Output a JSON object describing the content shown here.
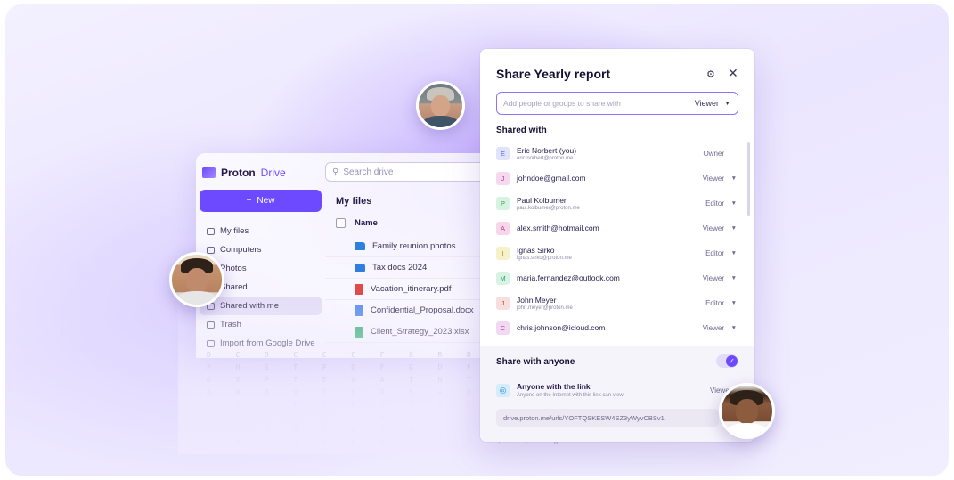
{
  "drive": {
    "brand_main": "Proton",
    "brand_sub": "Drive",
    "search_placeholder": "Search drive",
    "new_button": "New",
    "nav": [
      "My files",
      "Computers",
      "Photos",
      "Shared",
      "Shared with me",
      "Trash",
      "Import from Google Drive"
    ],
    "main_title": "My files",
    "column_name": "Name",
    "files": [
      {
        "name": "Family reunion photos",
        "type": "folder"
      },
      {
        "name": "Tax docs 2024",
        "type": "folder"
      },
      {
        "name": "Vacation_itinerary.pdf",
        "type": "pdf"
      },
      {
        "name": "Confidential_Proposal.docx",
        "type": "doc"
      },
      {
        "name": "Client_Strategy_2023.xlsx",
        "type": "sheet"
      }
    ],
    "cipher": "D  C  D  C  C  C  F  O  R  D  C  B  C\nP  H  S  T  P  D  F  G  D  F  P  F  F  G  M  H  P\nG  X  P  T  E  V  A  I  N  T  A  H  L\nA  N  D  V  3  H  R  S  +  H  E  3  S  3  R  S  A  N\nQ  X  T  R  S  P  U  S  X  R  Y  K  A  A\n4  F  5  P  P  5  D  C  G  F  E  G  C\nA  F  H  N  A  D  T  I  T  L  Y  Y  E  L\nD  N  C  Q  R  P  O  A  A  B  O  F  N"
  },
  "dialog": {
    "title": "Share Yearly report",
    "input_placeholder": "Add people or groups to share with",
    "input_role": "Viewer",
    "shared_with_label": "Shared with",
    "people": [
      {
        "initial": "E",
        "name": "Eric Norbert (you)",
        "email": "eric.norbert@proton.me",
        "role": "Owner",
        "has_caret": false,
        "bg": "#dfe3fb",
        "fg": "#5a66c9"
      },
      {
        "initial": "J",
        "name": "johndoe@gmail.com",
        "email": "",
        "role": "Viewer",
        "has_caret": true,
        "bg": "#f7d9ef",
        "fg": "#b6479a"
      },
      {
        "initial": "P",
        "name": "Paul Kolbumer",
        "email": "paul.kolbumer@proton.me",
        "role": "Editor",
        "has_caret": true,
        "bg": "#d6f2e0",
        "fg": "#3f9a62"
      },
      {
        "initial": "A",
        "name": "alex.smith@hotmail.com",
        "email": "",
        "role": "Viewer",
        "has_caret": true,
        "bg": "#f7d6ea",
        "fg": "#b6478a"
      },
      {
        "initial": "I",
        "name": "Ignas Sirko",
        "email": "ignas.sirko@proton.me",
        "role": "Editor",
        "has_caret": true,
        "bg": "#f6f1c9",
        "fg": "#a39324"
      },
      {
        "initial": "M",
        "name": "maria.fernandez@outlook.com",
        "email": "",
        "role": "Viewer",
        "has_caret": true,
        "bg": "#d6f3e4",
        "fg": "#3f9a72"
      },
      {
        "initial": "J",
        "name": "John Meyer",
        "email": "john.meyer@proton.me",
        "role": "Editor",
        "has_caret": true,
        "bg": "#f9dede",
        "fg": "#c24c4c"
      },
      {
        "initial": "C",
        "name": "chris.johnson@icloud.com",
        "email": "",
        "role": "Viewer",
        "has_caret": true,
        "bg": "#f3d8f3",
        "fg": "#a847a8"
      }
    ],
    "share_anyone_label": "Share with anyone",
    "toggle_on": true,
    "link_title": "Anyone with the link",
    "link_desc": "Anyone on the Internet with this link can view",
    "link_role": "Viewer",
    "link_url": "drive.proton.me/urls/YOFTQSKESW4SZ3yWyvCBSv1"
  },
  "colors": {
    "accent": "#6d4aff"
  }
}
